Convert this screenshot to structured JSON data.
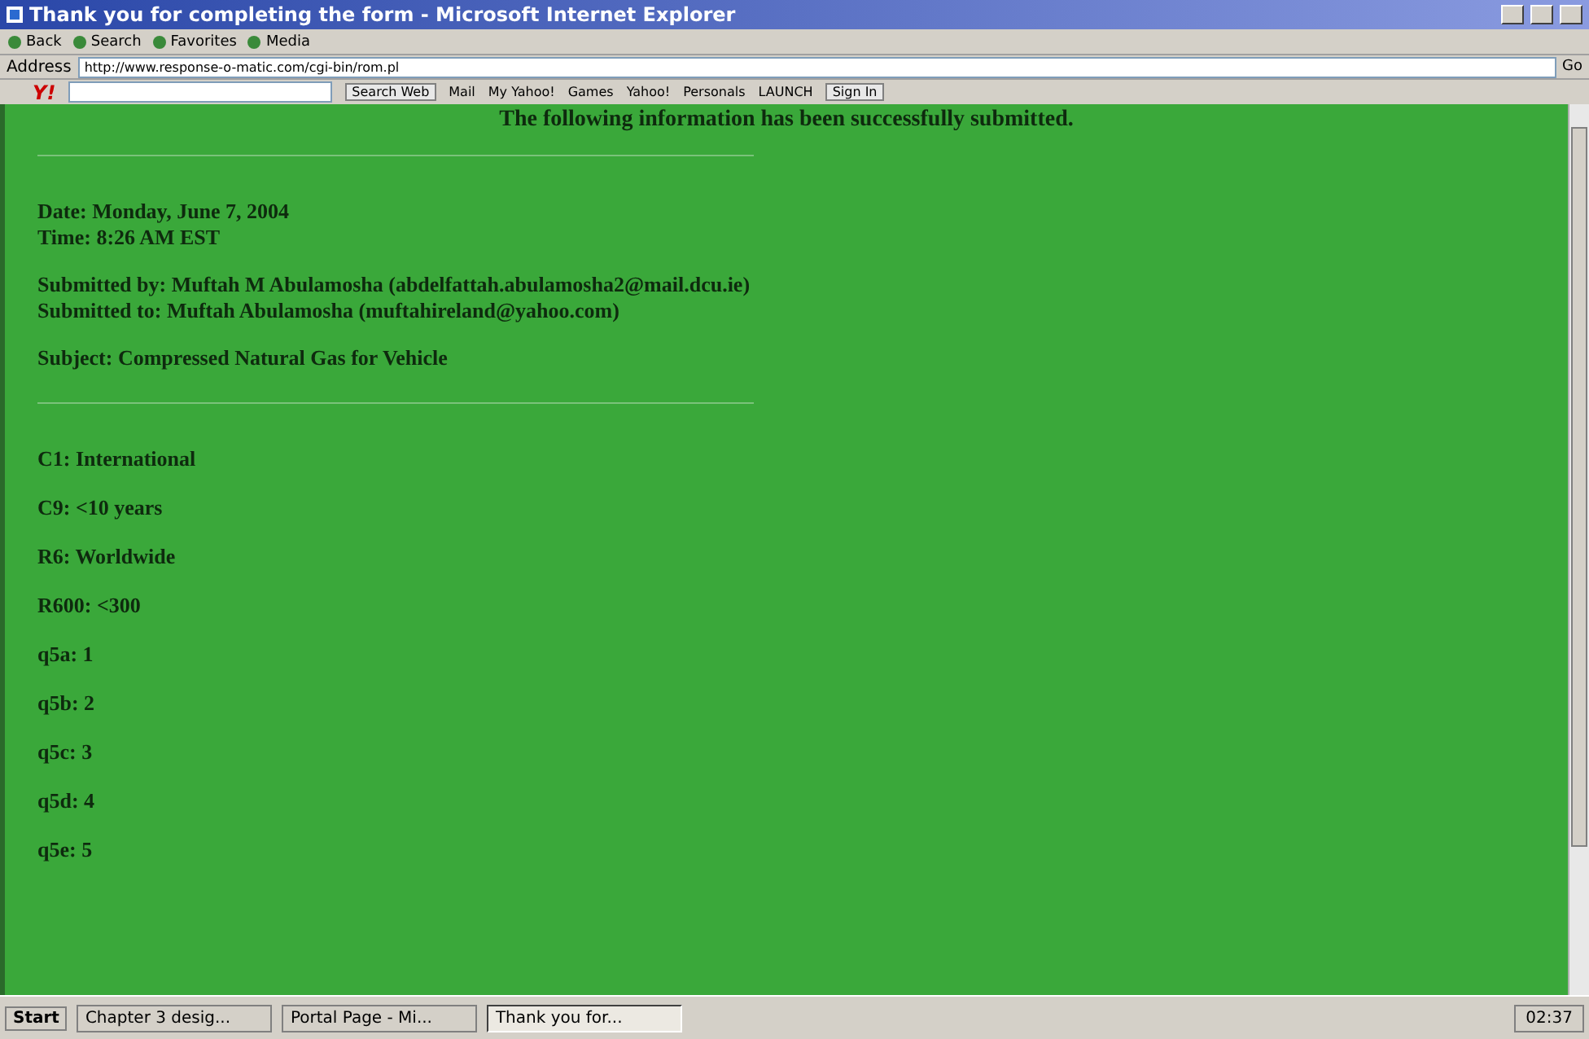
{
  "window": {
    "title": "Thank you for completing the form - Microsoft Internet Explorer"
  },
  "toolbar": {
    "buttons": [
      "Back",
      "Search",
      "Favorites",
      "Media"
    ]
  },
  "address_bar": {
    "label": "Address",
    "value": "http://www.response-o-matic.com/cgi-bin/rom.pl",
    "go": "Go"
  },
  "yahoo_toolbar": {
    "logo": "Y!",
    "search_button": "Search Web",
    "items": [
      "Mail",
      "My Yahoo!",
      "Games",
      "Yahoo!",
      "Personals",
      "LAUNCH"
    ],
    "sign_in": "Sign In"
  },
  "page": {
    "heading": "The following information has been successfully submitted.",
    "groups": [
      [
        "Date: Monday, June 7, 2004",
        "Time: 8:26 AM EST"
      ],
      [
        "Submitted by: Muftah M Abulamosha (abdelfattah.abulamosha2@mail.dcu.ie)",
        "Submitted to: Muftah Abulamosha (muftahireland@yahoo.com)"
      ],
      [
        "Subject: Compressed Natural Gas for Vehicle"
      ]
    ],
    "fields": [
      "C1: International",
      "C9: <10 years",
      "R6: Worldwide",
      "R600: <300",
      "q5a: 1",
      "q5b: 2",
      "q5c: 3",
      "q5d: 4",
      "q5e: 5"
    ]
  },
  "taskbar": {
    "start": "Start",
    "tasks": [
      {
        "label": "Chapter 3 desig...",
        "selected": false
      },
      {
        "label": "Portal Page - Mi...",
        "selected": false
      },
      {
        "label": "Thank you for...",
        "selected": true
      }
    ],
    "clock": "02:37"
  }
}
